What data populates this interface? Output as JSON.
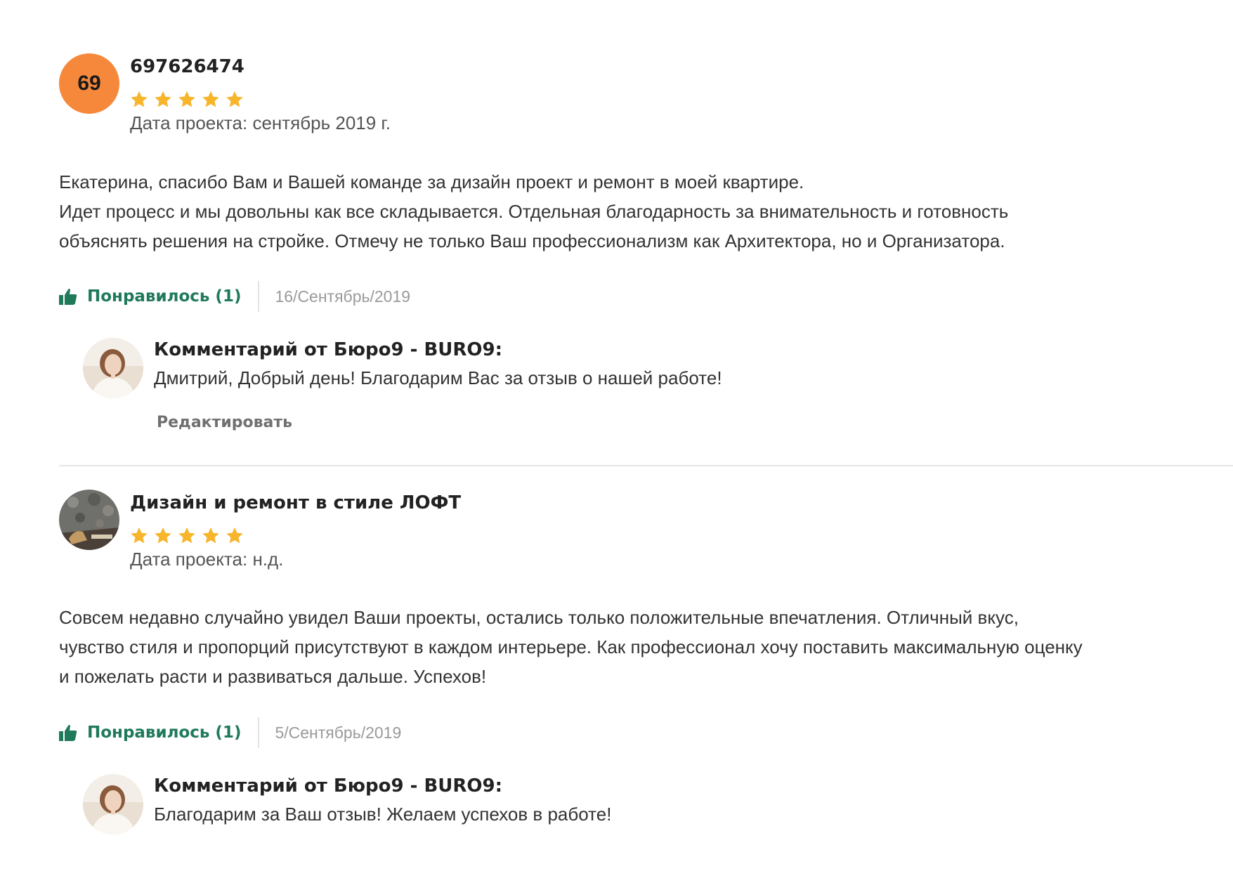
{
  "reviews": [
    {
      "avatar_text": "69",
      "author": "697626474",
      "rating": 5,
      "project_date": "Дата проекта: сентябрь 2019 г.",
      "text": "Екатерина, спасибо Вам и Вашей команде за дизайн проект и  ремонт в моей квартире.\nИдет процесс и мы довольны как все складывается. Отдельная благодарность за внимательность и готовность\nобъяснять  решения на стройке. Отмечу не только Ваш профессионализм как Архитектора, но и Организатора.",
      "like_label": "Понравилось (1)",
      "date": "16/Сентябрь/2019",
      "comment": {
        "title": "Комментарий от Бюро9 - BURO9:",
        "text": "Дмитрий, Добрый день! Благодарим Вас за отзыв о нашей работе!",
        "edit_label": "Редактировать"
      }
    },
    {
      "author": "Дизайн и ремонт в стиле ЛОФТ",
      "rating": 5,
      "project_date": "Дата проекта: н.д.",
      "text": "Совсем недавно случайно увидел Ваши проекты, остались только положительные впечатления. Отличный вкус,\nчувство стиля и пропорций присутствуют в каждом интерьере. Как профессионал хочу поставить максимальную оценку\nи пожелать расти и развиваться дальше. Успехов!",
      "like_label": "Понравилось (1)",
      "date": "5/Сентябрь/2019",
      "comment": {
        "title": "Комментарий от Бюро9 - BURO9:",
        "text": "Благодарим за Ваш отзыв! Желаем успехов в работе!"
      }
    }
  ],
  "colors": {
    "avatar_orange": "#f6883b",
    "star": "#f7b52c",
    "like_green": "#1f7a5a",
    "date_gray": "#9a9a9a"
  },
  "icons": {
    "like": "thumbs-up-icon",
    "star": "star-icon"
  }
}
